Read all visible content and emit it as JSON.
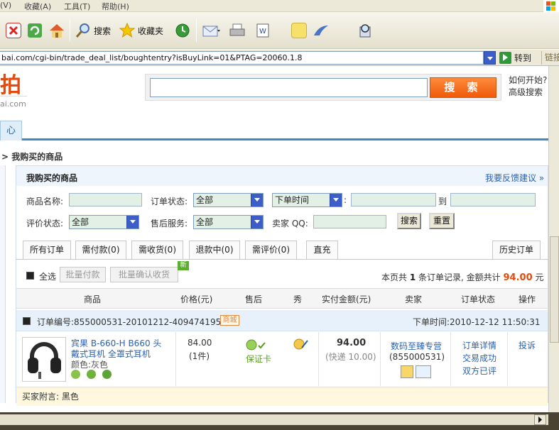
{
  "menubar": {
    "items": [
      "(V)",
      "收藏(A)",
      "工具(T)",
      "帮助(H)"
    ]
  },
  "toolbar": {
    "search_label": "搜索",
    "favorites_label": "收藏夹"
  },
  "address": {
    "url": "bai.com/cgi-bin/trade_deal_list/boughtentry?isBuyLink=01&PTAG=20060.1.8",
    "go_label": "转到",
    "links_label": "链接"
  },
  "header": {
    "logo_text": "拍",
    "logo_url": "ai.com",
    "search_button": "搜 索",
    "how_to_start": "如何开始?",
    "advanced_search": "高级搜索"
  },
  "nav": {
    "tab_label": "心"
  },
  "breadcrumb": "> 我购买的商品",
  "panel": {
    "title": "我购买的商品",
    "feedback": "我要反馈建议 »"
  },
  "filters": {
    "product_name_label": "商品名称:",
    "order_status_label": "订单状态:",
    "order_status_value": "全部",
    "time_select_value": "下单时间",
    "to_label": "到",
    "rating_status_label": "评价状态:",
    "rating_status_value": "全部",
    "after_sale_label": "售后服务:",
    "after_sale_value": "全部",
    "seller_qq_label": "卖家 QQ:",
    "search_button": "搜索",
    "reset_button": "重置"
  },
  "tabs": [
    "所有订单",
    "需付款(0)",
    "需收货(0)",
    "退款中(0)",
    "需评价(0)",
    "直充",
    "历史订单"
  ],
  "bulk": {
    "select_all": "全选",
    "batch_pay": "批量付款",
    "batch_confirm": "批量确认收货",
    "new_badge": "新"
  },
  "summary": {
    "prefix": "本页共",
    "count": "1",
    "middle": "条订单记录, 金额共计",
    "amount": "94.00",
    "suffix": "元"
  },
  "columns": [
    "商品",
    "价格(元)",
    "售后",
    "秀",
    "实付金额(元)",
    "卖家",
    "订单状态",
    "操作"
  ],
  "order": {
    "order_no": "订单编号:855000531-20101212-409474195",
    "mall_badge": "商城",
    "order_time": "下单时间:2010-12-12 11:50:31",
    "product_title_1": "宾果 B-660-H B660 头",
    "product_title_2": "戴式耳机 全罩式耳机",
    "product_color": "颜色:灰色",
    "price": "84.00",
    "quantity": "(1件)",
    "warranty": "保证卡",
    "paid": "94.00",
    "shipping": "(快递 10.00)",
    "seller_name": "数码至臻专营",
    "seller_qq": "(855000531)",
    "status_detail": "订单详情",
    "status_success": "交易成功",
    "status_rated": "双方已评",
    "complain": "投诉",
    "buyer_note": "买家附言: 黑色"
  }
}
